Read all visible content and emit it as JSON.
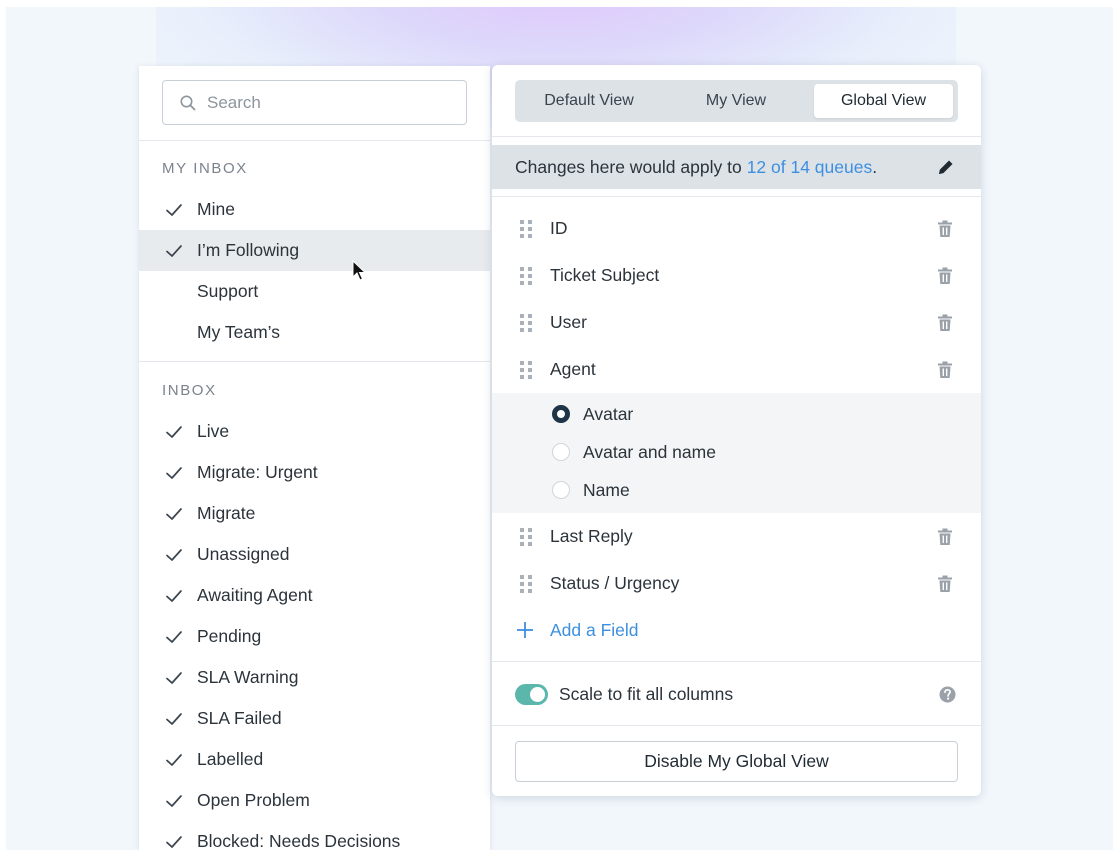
{
  "sidebar": {
    "search_placeholder": "Search",
    "my_inbox": {
      "title": "MY INBOX",
      "items": [
        {
          "label": "Mine",
          "checked": true,
          "active": false
        },
        {
          "label": "I’m Following",
          "checked": true,
          "active": true
        },
        {
          "label": "Support",
          "checked": false,
          "active": false
        },
        {
          "label": "My Team’s",
          "checked": false,
          "active": false
        }
      ]
    },
    "inbox": {
      "title": "INBOX",
      "items": [
        {
          "label": "Live",
          "checked": true
        },
        {
          "label": "Migrate: Urgent",
          "checked": true
        },
        {
          "label": "Migrate",
          "checked": true
        },
        {
          "label": "Unassigned",
          "checked": true
        },
        {
          "label": "Awaiting Agent",
          "checked": true
        },
        {
          "label": "Pending",
          "checked": true
        },
        {
          "label": "SLA Warning",
          "checked": true
        },
        {
          "label": "SLA Failed",
          "checked": true
        },
        {
          "label": "Labelled",
          "checked": true
        },
        {
          "label": "Open Problem",
          "checked": true
        },
        {
          "label": "Blocked: Needs Decisions",
          "checked": true
        }
      ]
    }
  },
  "view_panel": {
    "tabs": [
      {
        "label": "Default View",
        "selected": false
      },
      {
        "label": "My View",
        "selected": false
      },
      {
        "label": "Global View",
        "selected": true
      }
    ],
    "notice": {
      "prefix": "Changes here would apply to ",
      "link": "12 of 14 queues",
      "suffix": "."
    },
    "fields": [
      {
        "label": "ID"
      },
      {
        "label": "Ticket Subject"
      },
      {
        "label": "User"
      },
      {
        "label": "Agent"
      }
    ],
    "agent_display_options": [
      {
        "label": "Avatar",
        "checked": true
      },
      {
        "label": "Avatar and name",
        "checked": false
      },
      {
        "label": "Name",
        "checked": false
      }
    ],
    "fields_after": [
      {
        "label": "Last Reply"
      },
      {
        "label": "Status / Urgency"
      }
    ],
    "add_field_label": "Add a Field",
    "scale_toggle": {
      "label": "Scale to fit all columns",
      "on": true
    },
    "disable_button_label": "Disable My Global View"
  },
  "colors": {
    "accent_link": "#3d8fe0",
    "toggle_on": "#5bb7ac",
    "radio_checked": "#1f3447",
    "active_row": "#e8ebee"
  }
}
